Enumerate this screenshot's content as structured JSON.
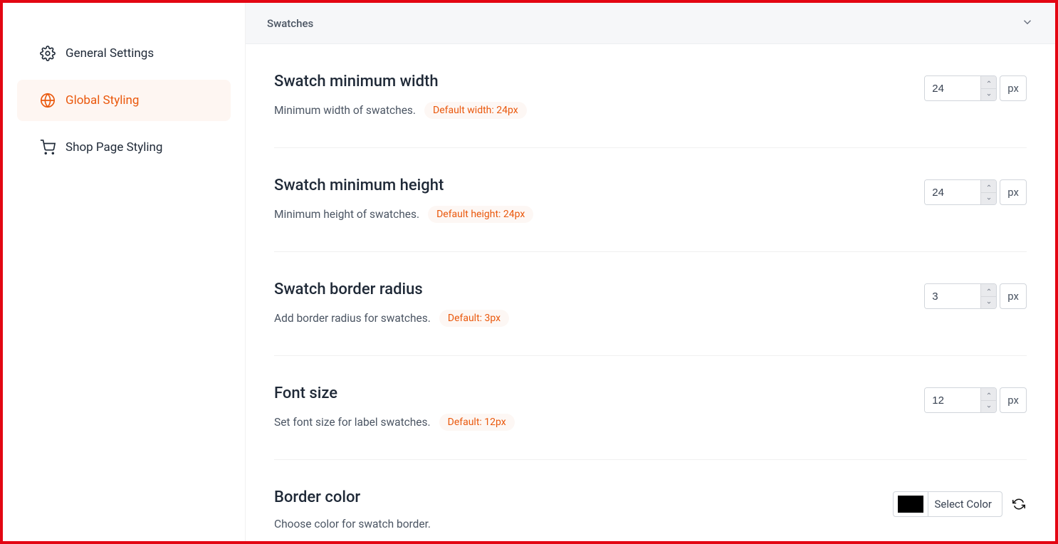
{
  "sidebar": {
    "items": [
      {
        "label": "General Settings",
        "icon": "gear"
      },
      {
        "label": "Global Styling",
        "icon": "globe"
      },
      {
        "label": "Shop Page Styling",
        "icon": "cart"
      }
    ],
    "activeIndex": 1
  },
  "section": {
    "title": "Swatches"
  },
  "settings": [
    {
      "title": "Swatch minimum width",
      "description": "Minimum width of swatches.",
      "defaultText": "Default width: 24px",
      "value": "24",
      "unit": "px",
      "control": "number"
    },
    {
      "title": "Swatch minimum height",
      "description": "Minimum height of swatches.",
      "defaultText": "Default height: 24px",
      "value": "24",
      "unit": "px",
      "control": "number"
    },
    {
      "title": "Swatch border radius",
      "description": "Add border radius for swatches.",
      "defaultText": "Default: 3px",
      "value": "3",
      "unit": "px",
      "control": "number"
    },
    {
      "title": "Font size",
      "description": "Set font size for label swatches.",
      "defaultText": "Default: 12px",
      "value": "12",
      "unit": "px",
      "control": "number"
    },
    {
      "title": "Border color",
      "description": "Choose color for swatch border.",
      "defaultText": "",
      "value": "#000000",
      "buttonLabel": "Select Color",
      "control": "color"
    }
  ]
}
